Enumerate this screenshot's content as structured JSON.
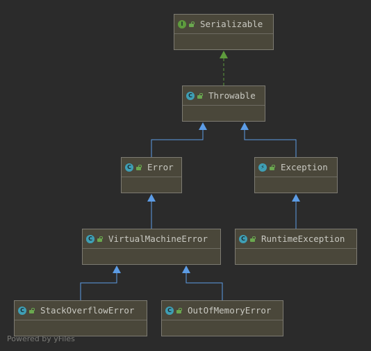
{
  "nodes": {
    "serializable": {
      "label": "Serializable",
      "badge": "I",
      "icon": "interface-icon"
    },
    "throwable": {
      "label": "Throwable",
      "badge": "C",
      "icon": "class-icon"
    },
    "error": {
      "label": "Error",
      "badge": "C",
      "icon": "class-icon"
    },
    "exception": {
      "label": "Exception",
      "badge": "⚡",
      "icon": "exception-class-icon"
    },
    "virtualmachineerror": {
      "label": "VirtualMachineError",
      "badge": "C",
      "icon": "abstract-class-icon"
    },
    "runtimeexception": {
      "label": "RuntimeException",
      "badge": "C",
      "icon": "class-icon"
    },
    "stackoverflowerror": {
      "label": "StackOverflowError",
      "badge": "C",
      "icon": "class-icon"
    },
    "outofmemoryerror": {
      "label": "OutOfMemoryError",
      "badge": "C",
      "icon": "class-icon"
    }
  },
  "edges": [
    {
      "from": "Throwable",
      "to": "Serializable",
      "kind": "implements"
    },
    {
      "from": "Error",
      "to": "Throwable",
      "kind": "extends"
    },
    {
      "from": "Exception",
      "to": "Throwable",
      "kind": "extends"
    },
    {
      "from": "VirtualMachineError",
      "to": "Error",
      "kind": "extends"
    },
    {
      "from": "RuntimeException",
      "to": "Exception",
      "kind": "extends"
    },
    {
      "from": "StackOverflowError",
      "to": "VirtualMachineError",
      "kind": "extends"
    },
    {
      "from": "OutOfMemoryError",
      "to": "VirtualMachineError",
      "kind": "extends"
    }
  ],
  "colors": {
    "background": "#2b2b2b",
    "node_fill": "#4a473a",
    "extends_arrow": "#5c9ce6",
    "implements_arrow": "#5e9b3d"
  },
  "watermark": "Powered by yFiles"
}
